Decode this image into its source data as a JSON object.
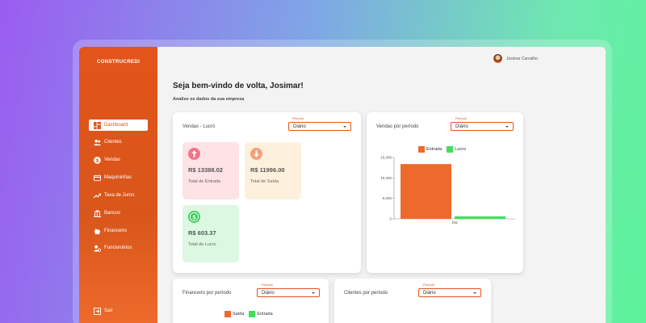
{
  "brand": "CONSTRUCREDI",
  "user": {
    "name": "Josimar Carvalho"
  },
  "welcome": "Seja bem-vindo de volta, Josimar!",
  "subtitle": "Analise os dados da sua empresa",
  "sidebar": {
    "items": [
      {
        "label": "Dashboard",
        "icon": "dashboard-icon",
        "active": true
      },
      {
        "label": "Clientes",
        "icon": "users-icon"
      },
      {
        "label": "Vendas",
        "icon": "dollar-icon"
      },
      {
        "label": "Maquininhas",
        "icon": "card-icon"
      },
      {
        "label": "Taxa de Juros",
        "icon": "trend-icon"
      },
      {
        "label": "Bancos",
        "icon": "bank-icon"
      },
      {
        "label": "Financeiro",
        "icon": "piggy-bank-icon"
      },
      {
        "label": "Funcionários",
        "icon": "employees-icon"
      }
    ],
    "logout": "Sair"
  },
  "cards": {
    "sales_profit": {
      "title": "Vendas - Lucro",
      "period_label": "Período",
      "period_value": "Diário",
      "stats": [
        {
          "value": "R$ 13388.02",
          "label": "Total de Entrada",
          "bg": "#fde2e6",
          "icon_color": "#f0748a",
          "icon": "arrow-up-icon"
        },
        {
          "value": "R$ 11996.00",
          "label": "Total de Saída",
          "bg": "#fdf1dd",
          "icon_color": "#f4a07a",
          "icon": "arrow-down-icon"
        },
        {
          "value": "R$ 603.37",
          "label": "Total de Lucro",
          "bg": "#dcf8e3",
          "icon_color": "#3ccf5c",
          "icon": "dollar-icon"
        }
      ]
    },
    "sales_period": {
      "title": "Vendas por período",
      "period_label": "Período",
      "period_value": "Diário",
      "legend": [
        "Entrada",
        "Lucro"
      ]
    },
    "finance_period": {
      "title": "Financeiro por período",
      "period_label": "Período",
      "period_value": "Diário",
      "legend": [
        "Saída",
        "Entrada"
      ]
    },
    "clients_period": {
      "title": "Clientes por período",
      "period_label": "Período",
      "period_value": "Diário"
    }
  },
  "colors": {
    "accent": "#e2541a",
    "entrada": "#ee6a2c",
    "lucro": "#3ee05a"
  },
  "chart_data": {
    "type": "bar",
    "categories": [
      "Dia"
    ],
    "series": [
      {
        "name": "Entrada",
        "values": [
          13388.02
        ]
      },
      {
        "name": "Lucro",
        "values": [
          603.37
        ]
      }
    ],
    "yticks": [
      "0",
      "5,000",
      "10,000",
      "15,000"
    ],
    "ylim": [
      0,
      15000
    ],
    "legend_position": "top"
  }
}
